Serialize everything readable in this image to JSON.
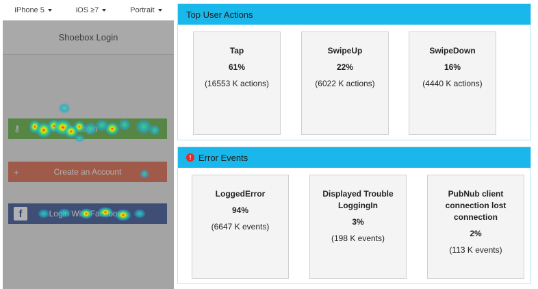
{
  "device_bar": {
    "device": "iPhone 5",
    "os": "iOS ≥7",
    "orientation": "Portrait"
  },
  "phone": {
    "title": "Shoebox Login",
    "buttons": [
      {
        "label": "Login",
        "icon": "key-icon"
      },
      {
        "label": "Create an Account",
        "icon": "plus-icon"
      },
      {
        "label": "Login With Facebook",
        "icon": "facebook-icon"
      }
    ],
    "heatmap": true
  },
  "top_actions": {
    "title": "Top User Actions",
    "items": [
      {
        "name": "Tap",
        "percent": "61%",
        "count": "(16553 K actions)"
      },
      {
        "name": "SwipeUp",
        "percent": "22%",
        "count": "(6022 K actions)"
      },
      {
        "name": "SwipeDown",
        "percent": "16%",
        "count": "(4440 K actions)"
      }
    ]
  },
  "error_events": {
    "title": "Error Events",
    "icon": "error-icon",
    "items": [
      {
        "name": "LoggedError",
        "percent": "94%",
        "count": "(6647 K events)"
      },
      {
        "name": "Displayed Trouble LoggingIn",
        "percent": "3%",
        "count": "(198 K events)"
      },
      {
        "name": "PubNub client connection lost connection",
        "percent": "2%",
        "count": "(113 K events)"
      }
    ]
  },
  "colors": {
    "panel_header": "#1ab7ea",
    "error_icon": "#e02b27",
    "login_button": "#7cbf62",
    "create_button": "#e5826a",
    "facebook_button": "#5a70a8"
  }
}
